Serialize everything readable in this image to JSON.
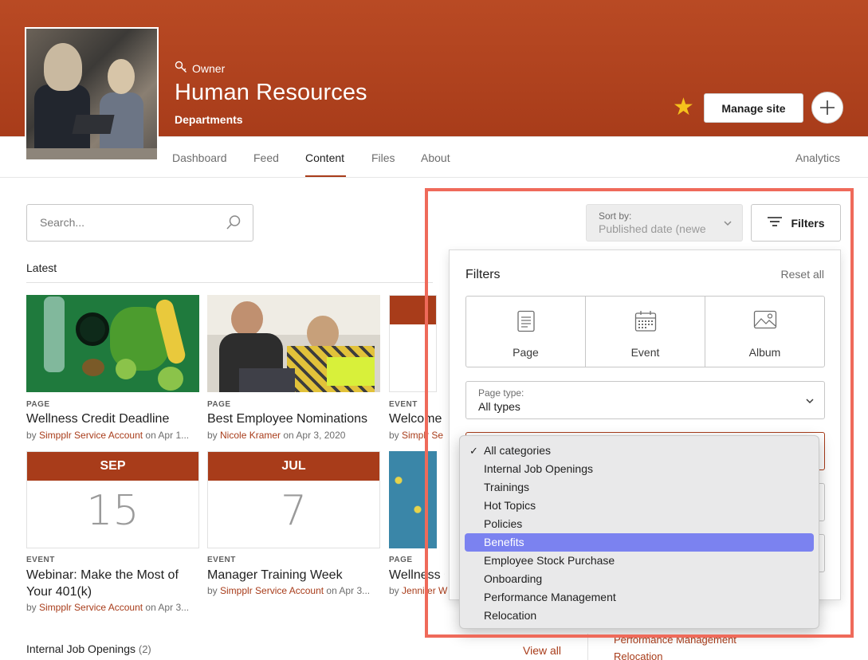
{
  "header": {
    "owner_label": "Owner",
    "title": "Human Resources",
    "subtitle": "Departments",
    "manage_label": "Manage site",
    "accent": "#a83c1a"
  },
  "tabs": [
    {
      "label": "Dashboard"
    },
    {
      "label": "Feed"
    },
    {
      "label": "Content"
    },
    {
      "label": "Files"
    },
    {
      "label": "About"
    }
  ],
  "analytics_label": "Analytics",
  "search": {
    "placeholder": "Search..."
  },
  "latest_label": "Latest",
  "cards": [
    {
      "kind": "PAGE",
      "title": "Wellness Credit Deadline",
      "by": "by ",
      "author": "Simpplr Service Account",
      "date": " on Apr 1..."
    },
    {
      "kind": "PAGE",
      "title": "Best Employee Nominations",
      "by": "by ",
      "author": "Nicole Kramer",
      "date": " on Apr 3, 2020"
    },
    {
      "kind": "EVENT",
      "title": "Welcome I",
      "by": "by ",
      "author": "Simplr Se",
      "date": ""
    },
    {
      "kind": "EVENT",
      "month": "SEP",
      "day": "15",
      "title": "Webinar: Make the Most of Your 401(k)",
      "by": "by ",
      "author": "Simpplr Service Account",
      "date": " on Apr 3..."
    },
    {
      "kind": "EVENT",
      "month": "JUL",
      "day": "7",
      "title": "Manager Training Week",
      "by": "by ",
      "author": "Simpplr Service Account",
      "date": " on Apr 3..."
    },
    {
      "kind": "PAGE",
      "title": "Wellness C",
      "by": "by ",
      "author": "Jennifer W",
      "date": ""
    }
  ],
  "section2": {
    "label": "Internal Job Openings",
    "count": "(2)",
    "view_all": "View all"
  },
  "underlay_links": [
    "Performance Management",
    "Relocation"
  ],
  "sort": {
    "label": "Sort by:",
    "value": "Published date (newe"
  },
  "filters_button": "Filters",
  "filters_panel": {
    "title": "Filters",
    "reset": "Reset all",
    "types": [
      {
        "label": "Page",
        "icon": "page-icon"
      },
      {
        "label": "Event",
        "icon": "calendar-icon"
      },
      {
        "label": "Album",
        "icon": "image-icon"
      }
    ],
    "page_type": {
      "label": "Page type:",
      "value": "All types"
    }
  },
  "category_dropdown": {
    "check": "✓",
    "options": [
      "All categories",
      "Internal Job Openings",
      "Trainings",
      "Hot Topics",
      "Policies",
      "Benefits",
      "Employee Stock Purchase",
      "Onboarding",
      "Performance Management",
      "Relocation"
    ],
    "checked": "All categories",
    "highlighted": "Benefits"
  }
}
